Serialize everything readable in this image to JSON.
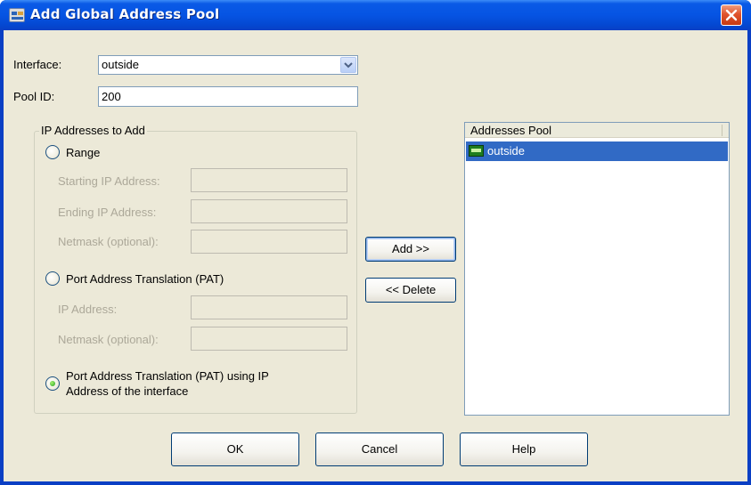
{
  "window": {
    "title": "Add Global Address Pool"
  },
  "form": {
    "interface_label": "Interface:",
    "interface_value": "outside",
    "pool_id_label": "Pool ID:",
    "pool_id_value": "200"
  },
  "ip_group": {
    "title": "IP Addresses to Add",
    "range_label": "Range",
    "starting_ip_label": "Starting IP Address:",
    "ending_ip_label": "Ending  IP Address:",
    "netmask_optional_label": "Netmask (optional):",
    "pat_label": "Port Address Translation (PAT)",
    "pat_ip_label": "IP Address:",
    "pat_netmask_label": "Netmask (optional):",
    "pat_interface_label_line1": "Port Address Translation (PAT) using IP",
    "pat_interface_label_line2": "Address of the interface",
    "selected_option": "pat_interface"
  },
  "actions": {
    "add_label": "Add >>",
    "delete_label": "<< Delete"
  },
  "pool_list": {
    "header": "Addresses Pool",
    "items": [
      {
        "label": "outside",
        "icon": "interface-icon",
        "selected": true
      }
    ]
  },
  "buttons": {
    "ok_label": "OK",
    "cancel_label": "Cancel",
    "help_label": "Help"
  },
  "colors": {
    "title_bar": "#0a5ae6",
    "selection": "#316ac5",
    "face": "#ece9d8",
    "close": "#e0532d"
  }
}
